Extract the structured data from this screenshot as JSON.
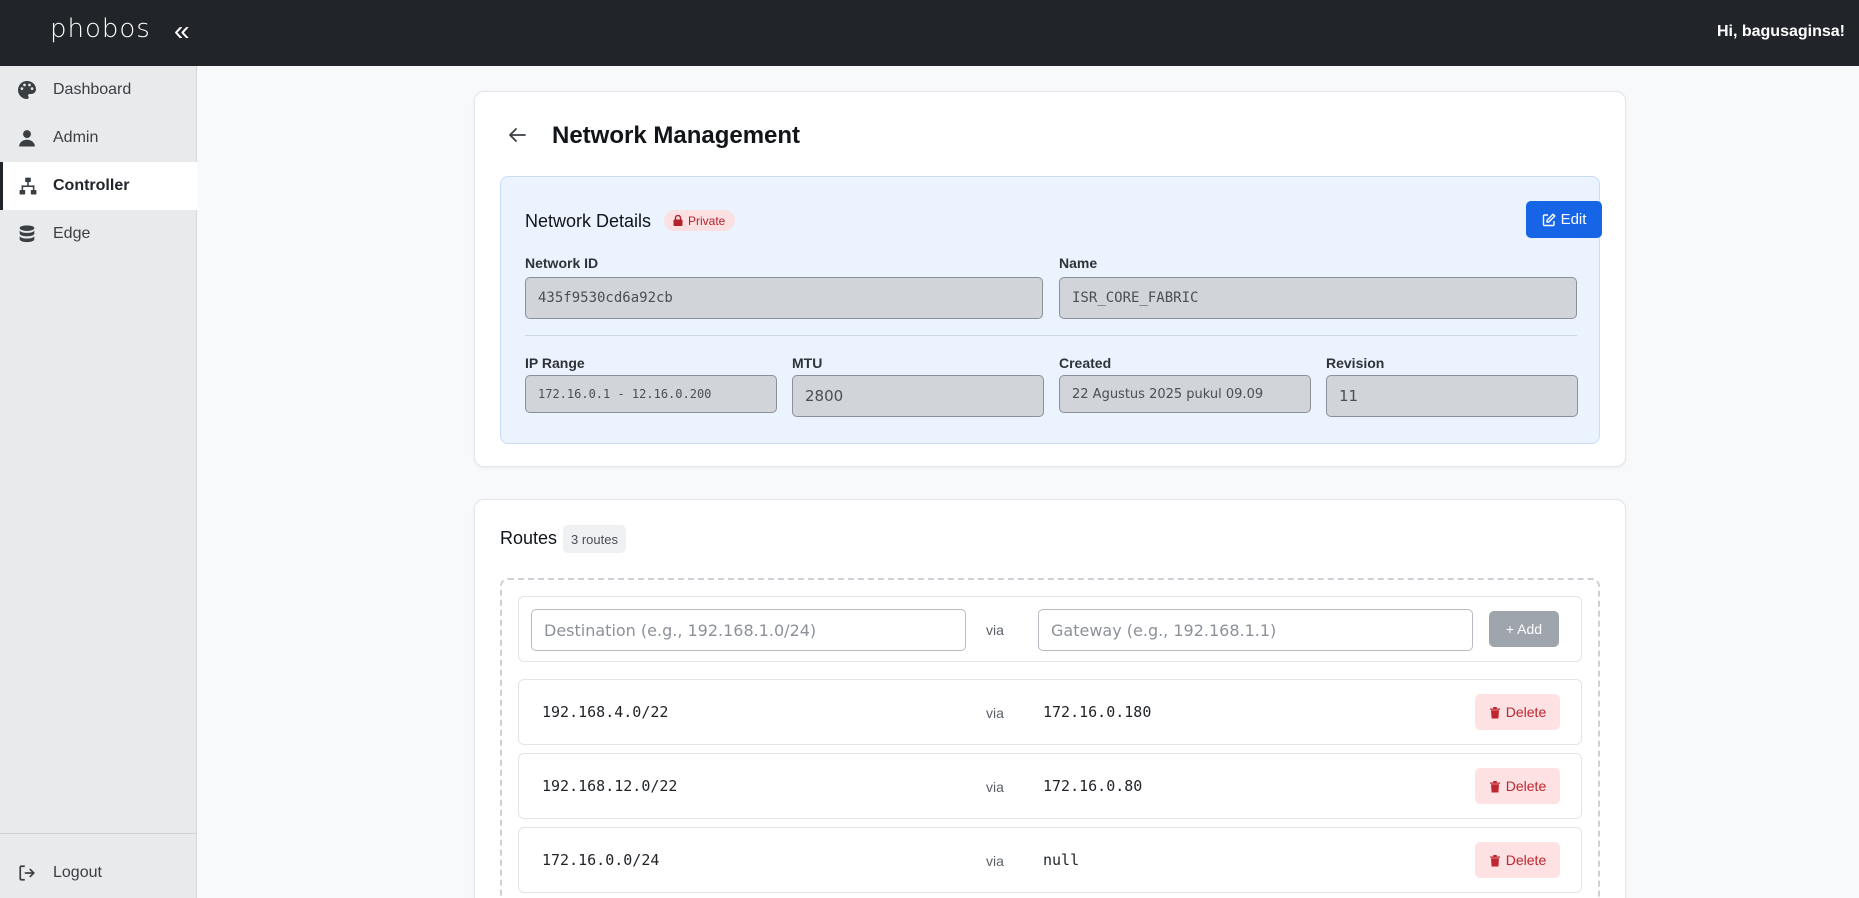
{
  "header": {
    "logo": "phobos",
    "collapse_icon": "«",
    "greeting": "Hi, bagusaginsa!"
  },
  "sidebar": {
    "items": [
      {
        "label": "Dashboard",
        "icon": "palette-icon"
      },
      {
        "label": "Admin",
        "icon": "user-icon"
      },
      {
        "label": "Controller",
        "icon": "network-icon",
        "active": true
      },
      {
        "label": "Edge",
        "icon": "database-icon"
      }
    ],
    "logout": "Logout"
  },
  "page": {
    "title": "Network Management"
  },
  "details": {
    "title": "Network Details",
    "badge": "Private",
    "edit_label": "Edit",
    "network_id_label": "Network ID",
    "network_id": "435f9530cd6a92cb",
    "name_label": "Name",
    "name": "ISR_CORE_FABRIC",
    "ip_range_label": "IP Range",
    "ip_range": "172.16.0.1 - 12.16.0.200",
    "mtu_label": "MTU",
    "mtu": "2800",
    "created_label": "Created",
    "created": "22 Agustus 2025 pukul 09.09",
    "revision_label": "Revision",
    "revision": "11"
  },
  "routes": {
    "title": "Routes",
    "count": "3 routes",
    "destination_placeholder": "Destination (e.g., 192.168.1.0/24)",
    "via": "via",
    "gateway_placeholder": "Gateway (e.g., 192.168.1.1)",
    "add_label": "+ Add",
    "delete_label": "Delete",
    "items": [
      {
        "destination": "192.168.4.0/22",
        "gateway": "172.16.0.180"
      },
      {
        "destination": "192.168.12.0/22",
        "gateway": "172.16.0.80"
      },
      {
        "destination": "172.16.0.0/24",
        "gateway": "null"
      }
    ]
  },
  "colors": {
    "topbar": "#212529",
    "primary": "#1565e6",
    "danger": "#c0262f"
  }
}
